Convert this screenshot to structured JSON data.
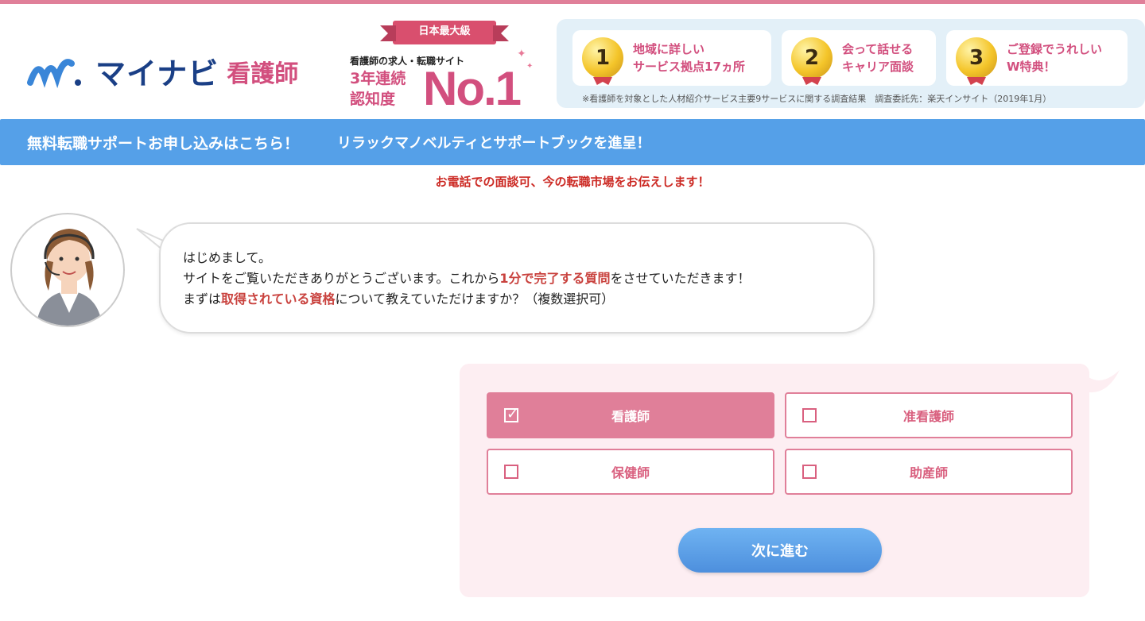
{
  "header": {
    "logo_text": "マイナビ",
    "logo_sub": "看護師",
    "award": {
      "ribbon": "日本最大級",
      "line1": "看護師の求人・転職サイト",
      "line2": "3年連続",
      "line3": "認知度",
      "rank": "No.1"
    },
    "features": [
      {
        "num": "1",
        "line1": "地域に詳しい",
        "line2": "サービス拠点17ヵ所"
      },
      {
        "num": "2",
        "line1": "会って話せる",
        "line2": "キャリア面談"
      },
      {
        "num": "3",
        "line1": "ご登録でうれしい",
        "line2": "W特典！"
      }
    ],
    "features_note": "※看護師を対象とした人材紹介サービス主要9サービスに関する調査結果　調査委託先：楽天インサイト（2019年1月）"
  },
  "banner": {
    "left": "無料転職サポートお申し込みはこちら！",
    "right": "リラックマノベルティとサポートブックを進呈！"
  },
  "notice": "お電話での面談可、今の転職市場をお伝えします！",
  "chat": {
    "line1": "はじめまして。",
    "line2_a": "サイトをご覧いただきありがとうございます。これから",
    "line2_hl": "1分で完了する質問",
    "line2_b": "をさせていただきます！",
    "line3_a": "まずは",
    "line3_hl": "取得されている資格",
    "line3_b": "について教えていただけますか？（複数選択可）"
  },
  "options": [
    {
      "label": "看護師",
      "selected": true
    },
    {
      "label": "准看護師",
      "selected": false
    },
    {
      "label": "保健師",
      "selected": false
    },
    {
      "label": "助産師",
      "selected": false
    }
  ],
  "next_button": "次に進む",
  "colors": {
    "brand_pink": "#e07f99",
    "brand_navy": "#1a3f86",
    "banner_blue": "#55a0e8",
    "highlight_red": "#c9423e"
  }
}
